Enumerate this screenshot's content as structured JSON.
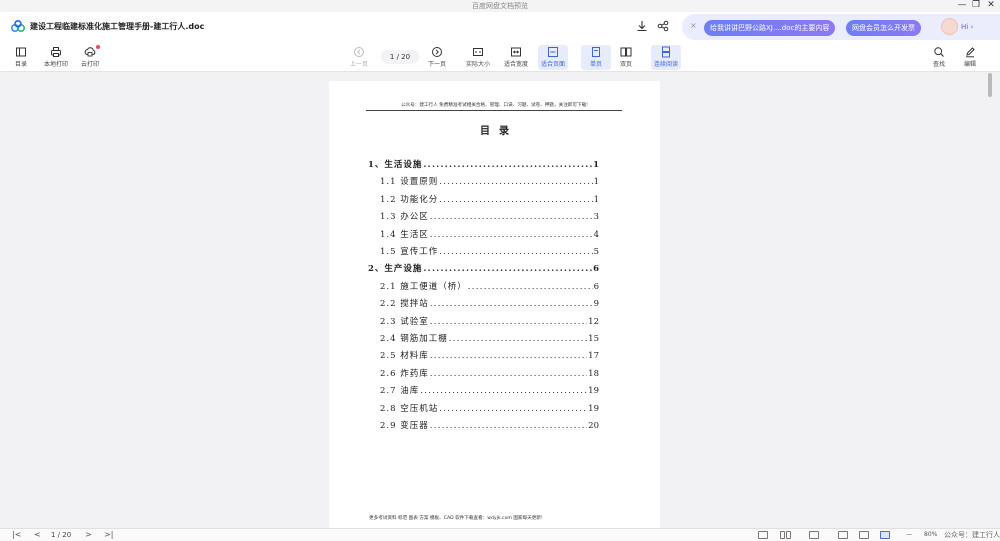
{
  "window": {
    "title": "百度网盘文档预览",
    "min_glyph": "—",
    "restore_glyph": "❐",
    "close_glyph": "✕"
  },
  "doc": {
    "name": "建设工程临建标准化施工管理手册-建工行人.doc"
  },
  "promo": {
    "close_glyph": "×",
    "ai_summary": "给我讲讲巴野公路XJ....doc的主要内容",
    "invoice": "网盘会员怎么开发票",
    "hi": "Hi"
  },
  "toolbar": {
    "left": [
      {
        "label": "目录",
        "icon": "toc-icon"
      },
      {
        "label": "本地打印",
        "icon": "printer-icon"
      },
      {
        "label": "云打印",
        "icon": "cloud-print-icon"
      }
    ],
    "prev": "上一页",
    "page_indicator": "1 / 20",
    "next": "下一页",
    "views": [
      {
        "label": "实际大小",
        "icon": "actual-size-icon"
      },
      {
        "label": "适合宽度",
        "icon": "fit-width-icon"
      },
      {
        "label": "适合页面",
        "icon": "fit-page-icon"
      },
      {
        "label": "单页",
        "icon": "single-page-icon"
      },
      {
        "label": "双页",
        "icon": "double-page-icon"
      },
      {
        "label": "连续阅读",
        "icon": "continuous-icon"
      }
    ],
    "right": [
      {
        "label": "查找",
        "icon": "search-icon"
      },
      {
        "label": "编辑",
        "icon": "edit-icon"
      }
    ]
  },
  "page": {
    "header": "公众号：建工行人 免费精准考试相关合格、管理、口诀、习题、试卷、押题，关注即可下载!",
    "toc_title": "目录",
    "entries": [
      {
        "level": 1,
        "title": "1、生活设施",
        "page": "1"
      },
      {
        "level": 2,
        "title": "1.1 设置原则",
        "page": "1"
      },
      {
        "level": 2,
        "title": "1.2 功能化分",
        "page": "1"
      },
      {
        "level": 2,
        "title": "1.3 办公区",
        "page": "3"
      },
      {
        "level": 2,
        "title": "1.4 生活区",
        "page": "4"
      },
      {
        "level": 2,
        "title": "1.5 宣传工作",
        "page": "5"
      },
      {
        "level": 1,
        "title": "2、生产设施",
        "page": "6"
      },
      {
        "level": 2,
        "title": "2.1 施工便道（桥）",
        "page": "6"
      },
      {
        "level": 2,
        "title": "2.2 搅拌站",
        "page": "9"
      },
      {
        "level": 2,
        "title": "2.3 试验室",
        "page": "12"
      },
      {
        "level": 2,
        "title": "2.4 钢筋加工棚",
        "page": "15"
      },
      {
        "level": 2,
        "title": "2.5 材料库",
        "page": "17"
      },
      {
        "level": 2,
        "title": "2.6 炸药库",
        "page": "18"
      },
      {
        "level": 2,
        "title": "2.7 油库",
        "page": "19"
      },
      {
        "level": 2,
        "title": "2.8 空压机站",
        "page": "19"
      },
      {
        "level": 2,
        "title": "2.9 变压器",
        "page": "20"
      }
    ],
    "footer": "更多考试资料 标范 图表 方案 模板、CAD 软件下载查看：wdyjk.com 国家每天更新!"
  },
  "bottom": {
    "first": "|<",
    "prev": "<",
    "page_indicator": "1 / 20",
    "next": ">",
    "last": ">|",
    "zoom_minus": "—",
    "zoom": "80%",
    "watermark": "公众号：建工行人"
  },
  "colors": {
    "accent": "#3f63d8",
    "active_bg": "#e6ecfb",
    "promo_bg": "#ebedfd",
    "badge": "#f2455e"
  }
}
